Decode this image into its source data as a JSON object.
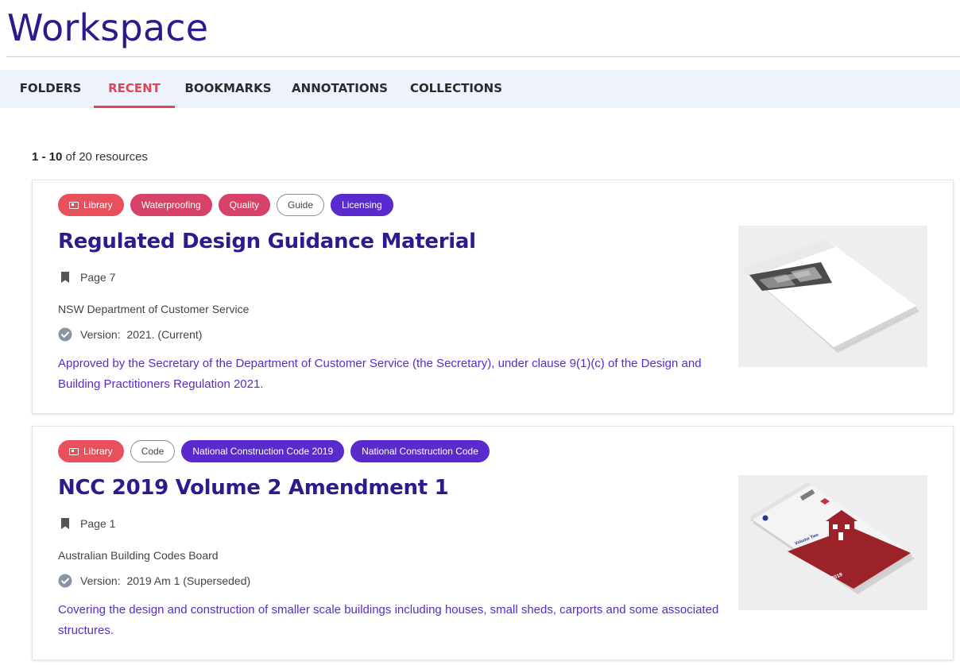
{
  "page": {
    "title": "Workspace"
  },
  "tabs": [
    {
      "label": "FOLDERS",
      "active": false
    },
    {
      "label": "RECENT",
      "active": true
    },
    {
      "label": "BOOKMARKS",
      "active": false
    },
    {
      "label": "ANNOTATIONS",
      "active": false
    },
    {
      "label": "COLLECTIONS",
      "active": false
    }
  ],
  "results": {
    "range": "1 - 10",
    "suffix": "of 20 resources"
  },
  "resources": [
    {
      "tags": [
        {
          "label": "Library",
          "style": "library",
          "icon": "library-icon"
        },
        {
          "label": "Waterproofing",
          "style": "pink"
        },
        {
          "label": "Quality",
          "style": "pink"
        },
        {
          "label": "Guide",
          "style": "outline"
        },
        {
          "label": "Licensing",
          "style": "purple"
        }
      ],
      "title": "Regulated Design Guidance Material",
      "page": "Page 7",
      "publisher": "NSW Department of Customer Service",
      "version_label": "Version:",
      "version": "2021. (Current)",
      "description": "Approved by the Secretary of the Department of Customer Service (the Secretary), under clause 9(1)(c) of the Design and Building Practitioners Regulation 2021."
    },
    {
      "tags": [
        {
          "label": "Library",
          "style": "library",
          "icon": "library-icon"
        },
        {
          "label": "Code",
          "style": "outline"
        },
        {
          "label": "National Construction Code 2019",
          "style": "purple"
        },
        {
          "label": "National Construction Code",
          "style": "purple"
        }
      ],
      "title": "NCC 2019 Volume 2 Amendment 1",
      "page": "Page 1",
      "publisher": "Australian Building Codes Board",
      "version_label": "Version:",
      "version": "2019 Am 1 (Superseded)",
      "description": "Covering the design and construction of smaller scale buildings including houses, small sheds, carports and some associated structures.",
      "cover": {
        "volume_text": "Volume Two",
        "year": "2019"
      }
    }
  ],
  "colors": {
    "brand_navy": "#2e1a8c",
    "accent_red": "#e0455a",
    "purple": "#5a2bcc",
    "pink": "#d6426a",
    "cover_red": "#9b2228"
  }
}
